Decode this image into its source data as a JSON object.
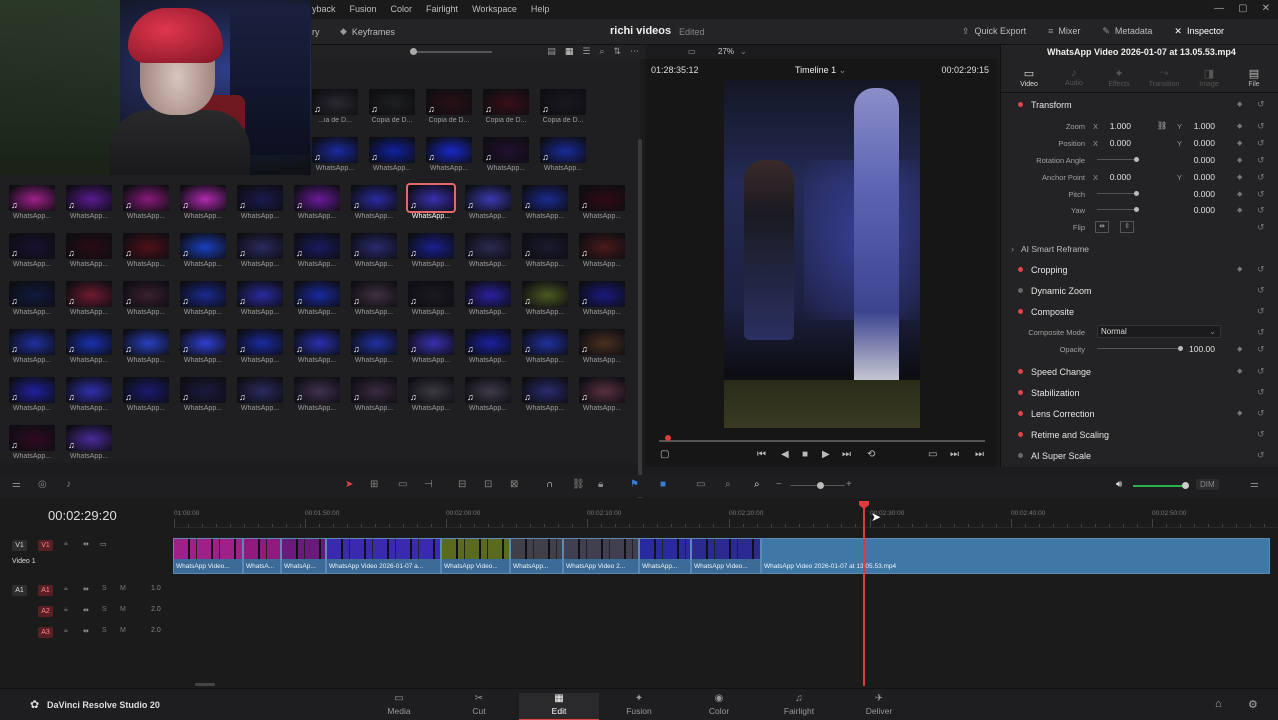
{
  "menu": [
    "yback",
    "Fusion",
    "Color",
    "Fairlight",
    "Workspace",
    "Help"
  ],
  "window_controls": [
    "—",
    "▢",
    "✕"
  ],
  "toolbar": {
    "left_tag": "ry",
    "keyframes_label": "Keyframes",
    "project_name": "richi videos",
    "status": "Edited",
    "zoom": "27%",
    "quick_export": "Quick Export",
    "mixer": "Mixer",
    "metadata": "Metadata",
    "inspector": "Inspector"
  },
  "media_pool": {
    "rows": [
      {
        "labels": [
          "...ia de D...",
          "Copia de D...",
          "Copia de D...",
          "Copia de D...",
          "Copia de D...",
          "Copia de D..."
        ],
        "colors": [
          "#2a2a2e",
          "#1e2020",
          "#2a1014",
          "#3a0f18",
          "#1a1a1e",
          "#201418"
        ]
      },
      {
        "labels": [
          "WhatsApp...",
          "WhatsApp...",
          "WhatsApp...",
          "WhatsApp...",
          "WhatsApp...",
          "WhatsApp..."
        ],
        "colors": [
          "#1a2aa0",
          "#1020a0",
          "#1828c8",
          "#221030",
          "#1a2a9a",
          "#101030"
        ]
      },
      {
        "labels": [
          "WhatsApp...",
          "WhatsApp...",
          "WhatsApp...",
          "WhatsApp...",
          "WhatsApp...",
          "WhatsApp...",
          "WhatsApp...",
          "WhatsApp...",
          "WhatsApp...",
          "WhatsApp...",
          "WhatsApp...",
          "WhatsApp..."
        ],
        "colors": [
          "#a0208a",
          "#5a1a90",
          "#8a1a7a",
          "#b02ab0",
          "#1a1a50",
          "#6a1a9a",
          "#2a2aa0",
          "#3a30b0",
          "#3a3ab0",
          "#1a2a90",
          "#300a14",
          "#1030c0"
        ]
      },
      {
        "labels": [
          "WhatsApp...",
          "WhatsApp...",
          "WhatsApp...",
          "WhatsApp...",
          "WhatsApp...",
          "WhatsApp...",
          "WhatsApp...",
          "WhatsApp...",
          "WhatsApp...",
          "WhatsApp...",
          "WhatsApp...",
          "WhatsApp..."
        ],
        "colors": [
          "#1a1030",
          "#2a0a14",
          "#501018",
          "#1a40c0",
          "#2a2a60",
          "#1a1a60",
          "#2a2a70",
          "#1a2090",
          "#2a2a50",
          "#1a1a30",
          "#4a1a1a",
          "#6a2a2a"
        ]
      },
      {
        "labels": [
          "WhatsApp...",
          "WhatsApp...",
          "WhatsApp...",
          "WhatsApp...",
          "WhatsApp...",
          "WhatsApp...",
          "WhatsApp...",
          "WhatsApp...",
          "WhatsApp...",
          "WhatsApp...",
          "WhatsApp...",
          "WhatsApp..."
        ],
        "colors": [
          "#101a40",
          "#701a30",
          "#3a2030",
          "#1a2a90",
          "#2a2aa0",
          "#1a2aa0",
          "#403040",
          "#1a1a20",
          "#2a20a0",
          "#4a5a20",
          "#1a1a80",
          "#2030c0"
        ]
      },
      {
        "labels": [
          "WhatsApp...",
          "WhatsApp...",
          "WhatsApp...",
          "WhatsApp...",
          "WhatsApp...",
          "WhatsApp...",
          "WhatsApp...",
          "WhatsApp...",
          "WhatsApp...",
          "WhatsApp...",
          "WhatsApp...",
          "WhatsApp..."
        ],
        "colors": [
          "#2030a0",
          "#1a30b0",
          "#2a40c0",
          "#3040d0",
          "#1a2aa0",
          "#2a30b0",
          "#2030a0",
          "#3a30b0",
          "#1a20a0",
          "#2030a0",
          "#4a3020",
          "#2a2a90"
        ]
      },
      {
        "labels": [
          "WhatsApp...",
          "WhatsApp...",
          "WhatsApp...",
          "WhatsApp...",
          "WhatsApp...",
          "WhatsApp...",
          "WhatsApp...",
          "WhatsApp...",
          "WhatsApp...",
          "WhatsApp...",
          "WhatsApp...",
          "WhatsApp..."
        ],
        "colors": [
          "#2020a0",
          "#3030b0",
          "#1a1a70",
          "#1a1a40",
          "#2a2a60",
          "#403050",
          "#3a2a40",
          "#3a3a40",
          "#403a4a",
          "#2a2a70",
          "#5a3040",
          "#2a2a70"
        ]
      },
      {
        "labels": [
          "WhatsApp...",
          "WhatsApp..."
        ],
        "colors": [
          "#300a20",
          "#4a2a9a"
        ]
      }
    ],
    "selected_row": 2,
    "selected_index": 7
  },
  "viewer": {
    "timecode_left": "01:28:35:12",
    "timeline_name": "Timeline 1",
    "timecode_right": "00:02:29:15"
  },
  "inspector": {
    "clip_name": "WhatsApp Video 2026-01-07 at 13.05.53.mp4",
    "tabs": [
      "Video",
      "Audio",
      "Effects",
      "Transition",
      "Image",
      "File"
    ],
    "transform": "Transform",
    "zoom_label": "Zoom",
    "zoom_x": "1.000",
    "zoom_y": "1.000",
    "position_label": "Position",
    "position_x": "0.000",
    "position_y": "0.000",
    "rotation_label": "Rotation Angle",
    "rotation": "0.000",
    "anchor_label": "Anchor Point",
    "anchor_x": "0.000",
    "anchor_y": "0.000",
    "pitch_label": "Pitch",
    "pitch": "0.000",
    "yaw_label": "Yaw",
    "yaw": "0.000",
    "flip_label": "Flip",
    "ai_smart_reframe": "AI Smart Reframe",
    "cropping": "Cropping",
    "dynamic_zoom": "Dynamic Zoom",
    "composite": "Composite",
    "composite_mode_label": "Composite Mode",
    "composite_mode": "Normal",
    "opacity_label": "Opacity",
    "opacity": "100.00",
    "speed_change": "Speed Change",
    "stabilization": "Stabilization",
    "lens_correction": "Lens Correction",
    "retime_scaling": "Retime and Scaling",
    "ai_super_scale": "AI Super Scale",
    "axis_x": "X",
    "axis_y": "Y"
  },
  "timeline": {
    "timecode": "00:02:29:20",
    "ruler_labels": [
      "01:00:00",
      "00:01:50:00",
      "00:02:00:00",
      "00:02:10:00",
      "00:02:20:00",
      "00:02:30:00",
      "00:02:40:00",
      "00:02:50:00"
    ],
    "video_track": {
      "id": "V1",
      "name": "Video 1"
    },
    "audio_tracks": [
      {
        "id": "A1",
        "level": "1.0"
      },
      {
        "id": "A2",
        "level": "2.0"
      },
      {
        "id": "A3",
        "level": "2.0"
      }
    ],
    "clips": [
      {
        "name": "WhatsApp Video...",
        "strip": "#a0208a"
      },
      {
        "name": "WhatsA...",
        "strip": "#901a80"
      },
      {
        "name": "WhatsAp...",
        "strip": "#6a1a7a"
      },
      {
        "name": "WhatsApp Video 2026-01-07 a...",
        "strip": "#3a2ab0"
      },
      {
        "name": "WhatsApp Video...",
        "strip": "#5a6a20"
      },
      {
        "name": "WhatsApp...",
        "strip": "#404048"
      },
      {
        "name": "WhatsApp Video 2...",
        "strip": "#404050"
      },
      {
        "name": "WhatsApp...",
        "strip": "#2a2aa0"
      },
      {
        "name": "WhatsApp Video...",
        "strip": "#2a2a90"
      },
      {
        "name": "WhatsApp Video 2026-01-07 at 13.05.53.mp4",
        "strip": ""
      }
    ],
    "track_tools": [
      "S",
      "M"
    ]
  },
  "pages": [
    {
      "label": "Media"
    },
    {
      "label": "Cut"
    },
    {
      "label": "Edit"
    },
    {
      "label": "Fusion"
    },
    {
      "label": "Color"
    },
    {
      "label": "Fairlight"
    },
    {
      "label": "Deliver"
    }
  ],
  "active_page": "Edit",
  "brand": "DaVinci Resolve Studio 20",
  "accent_color": "#e04646"
}
